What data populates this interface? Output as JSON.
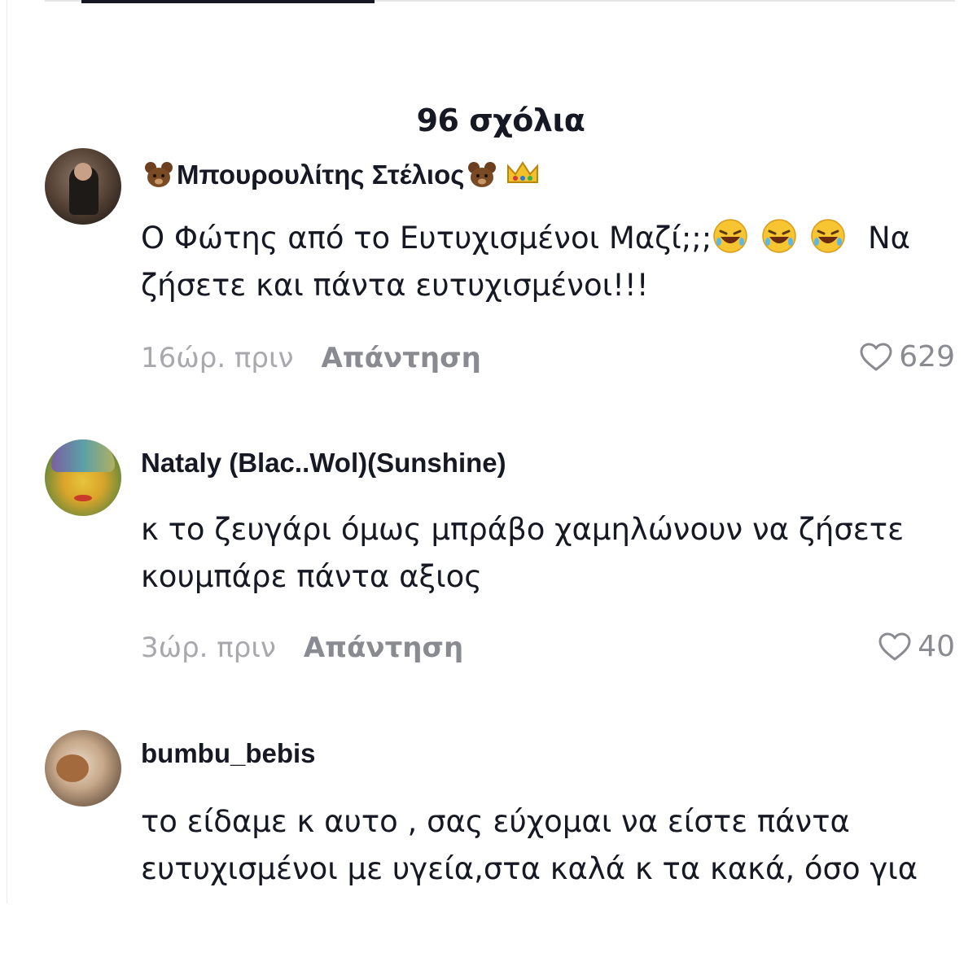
{
  "header": {
    "comment_count": "96 σχόλια"
  },
  "comments": [
    {
      "username": "Μπουρουλίτης Στέλιος",
      "text": "Ο Φώτης από το Ευτυχισμένοι Μαζί;;;",
      "text_after": " Να ζήσετε και πάντα ευτυχισμένοι!!!",
      "time": "16ώρ. πριν",
      "reply": "Απάντηση",
      "likes": "629"
    },
    {
      "username": "Nataly (Blac..Wol)(Sunshine)",
      "text": "κ το ζευγάρι όμως μπράβο χαμηλώνουν να ζήσετε κουμπάρε πάντα αξιος",
      "time": "3ώρ. πριν",
      "reply": "Απάντηση",
      "likes": "40"
    },
    {
      "username": "bumbu_bebis",
      "text": "το είδαμε κ αυτο , σας εύχομαι να είστε πάντα ευτυχισμένοι με υγεία,στα καλά κ τα κακά, όσο για"
    }
  ],
  "colors": {
    "text": "#161823",
    "muted": "#a8a8ad",
    "secondary": "#8a8b91"
  },
  "icons": [
    "heart-icon",
    "laughing-emoji-icon",
    "bear-emoji-icon",
    "crown-emoji-icon"
  ]
}
